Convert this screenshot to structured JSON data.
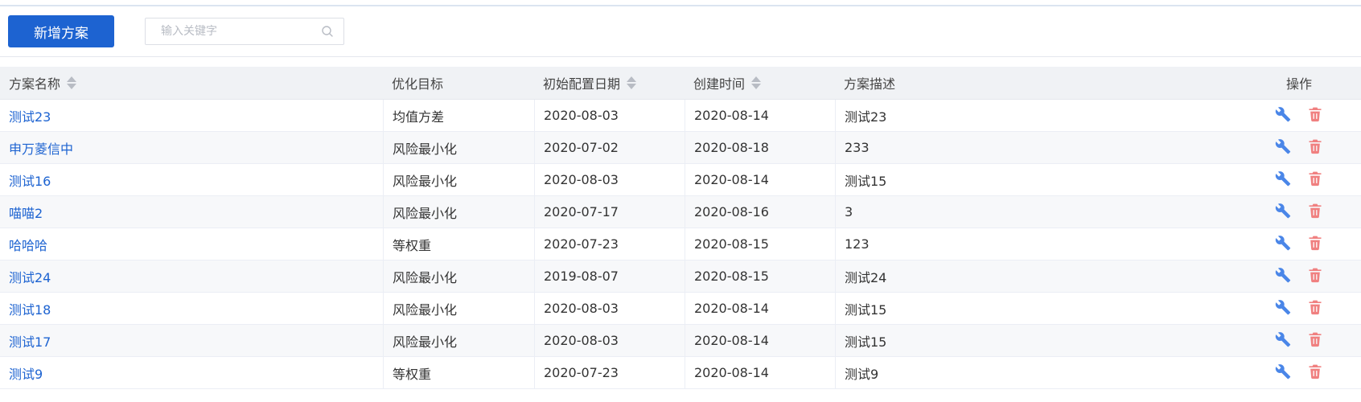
{
  "toolbar": {
    "add_label": "新增方案",
    "search_placeholder": "输入关键字",
    "search_value": ""
  },
  "colors": {
    "primary": "#1d63d1",
    "link": "#1d63d1",
    "edit_icon": "#4a86e8",
    "delete_icon": "#f08080",
    "header_bg": "#f0f2f5",
    "alt_row_bg": "#f7f8fa"
  },
  "table": {
    "headers": {
      "name": "方案名称",
      "target": "优化目标",
      "init_date": "初始配置日期",
      "created": "创建时间",
      "desc": "方案描述",
      "ops": "操作"
    },
    "sortable": [
      "name",
      "init_date",
      "created"
    ],
    "actions": {
      "edit_icon": "wrench-icon",
      "delete_icon": "trash-icon"
    },
    "rows": [
      {
        "name": "测试23",
        "target": "均值方差",
        "init_date": "2020-08-03",
        "created": "2020-08-14",
        "desc": "测试23"
      },
      {
        "name": "申万菱信中",
        "target": "风险最小化",
        "init_date": "2020-07-02",
        "created": "2020-08-18",
        "desc": "233"
      },
      {
        "name": "测试16",
        "target": "风险最小化",
        "init_date": "2020-08-03",
        "created": "2020-08-14",
        "desc": "测试15"
      },
      {
        "name": "喵喵2",
        "target": "风险最小化",
        "init_date": "2020-07-17",
        "created": "2020-08-16",
        "desc": "3"
      },
      {
        "name": "哈哈哈",
        "target": "等权重",
        "init_date": "2020-07-23",
        "created": "2020-08-15",
        "desc": "123"
      },
      {
        "name": "测试24",
        "target": "风险最小化",
        "init_date": "2019-08-07",
        "created": "2020-08-15",
        "desc": "测试24"
      },
      {
        "name": "测试18",
        "target": "风险最小化",
        "init_date": "2020-08-03",
        "created": "2020-08-14",
        "desc": "测试15"
      },
      {
        "name": "测试17",
        "target": "风险最小化",
        "init_date": "2020-08-03",
        "created": "2020-08-14",
        "desc": "测试15"
      },
      {
        "name": "测试9",
        "target": "等权重",
        "init_date": "2020-07-23",
        "created": "2020-08-14",
        "desc": "测试9"
      }
    ]
  }
}
